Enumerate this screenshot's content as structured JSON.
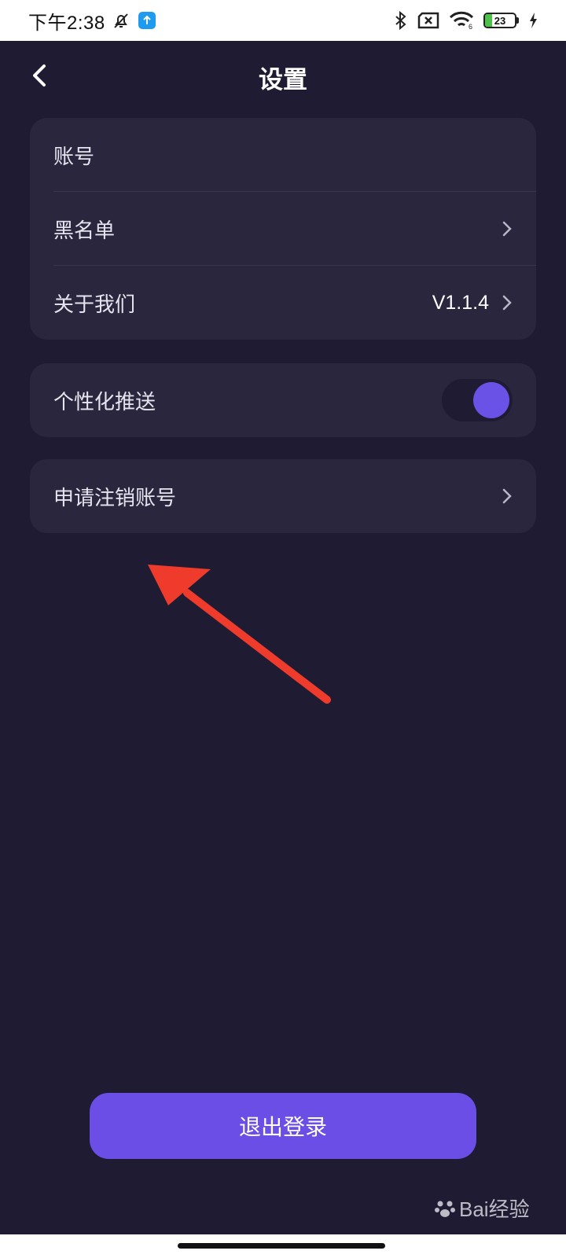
{
  "status_bar": {
    "time": "下午2:38",
    "battery_level": "23",
    "battery_fraction": 0.23,
    "icons": [
      "bell-off-icon",
      "app-notification-icon",
      "bluetooth-icon",
      "sim-off-icon",
      "wifi-icon",
      "battery-icon",
      "charging-icon"
    ]
  },
  "header": {
    "title": "设置",
    "back_icon": "chevron-left-icon"
  },
  "account_group": {
    "items": [
      {
        "label": "账号"
      },
      {
        "label": "黑名单"
      },
      {
        "label": "关于我们",
        "value": "V1.1.4"
      }
    ]
  },
  "push_group": {
    "label": "个性化推送",
    "enabled": true
  },
  "cancel_group": {
    "label": "申请注销账号"
  },
  "logout": {
    "label": "退出登录"
  },
  "watermark": {
    "text": "Bai经验"
  },
  "colors": {
    "background": "#1f1b33",
    "card": "#2a263e",
    "accent": "#6a52e6",
    "annotation": "#ee3b2b"
  }
}
